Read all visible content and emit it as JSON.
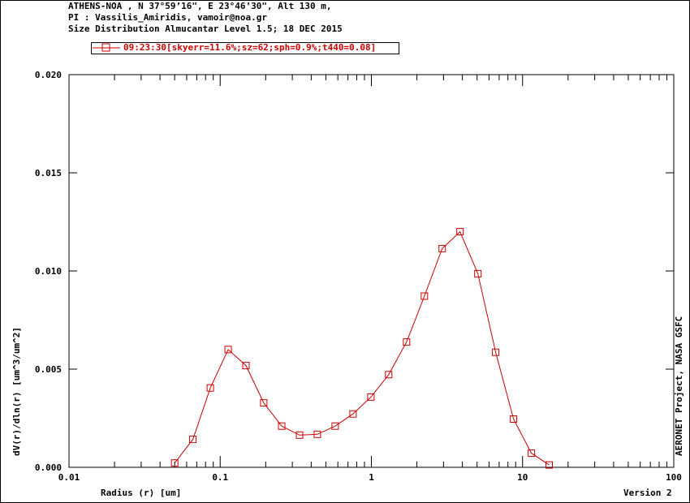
{
  "header": {
    "line1": "ATHENS-NOA , N 37°59’16\", E 23°46’30\", Alt 130 m,",
    "line2": "PI : Vassilis_Amiridis, vamoir@noa.gr",
    "line3": "Size Distribution Almucantar Level 1.5; 18 DEC 2015"
  },
  "right_label": "AERONET Project, NASA GSFC",
  "version_label": "Version 2",
  "colors": {
    "series": "#cc0000",
    "axis": "#000000"
  },
  "chart_data": {
    "type": "line",
    "xscale": "log",
    "xlabel": "Radius (r) [um]",
    "ylabel": "dV(r)/dln(r) [um^3/um^2]",
    "xlim": [
      0.01,
      100
    ],
    "ylim": [
      0.0,
      0.02
    ],
    "x_tick_labels": [
      "0.01",
      "0.1",
      "1",
      "10",
      "100"
    ],
    "y_tick_labels": [
      "0.000",
      "0.005",
      "0.010",
      "0.015",
      "0.020"
    ],
    "x_tick_values": [
      0.01,
      0.1,
      1,
      10,
      100
    ],
    "y_tick_values": [
      0,
      0.005,
      0.01,
      0.015,
      0.02
    ],
    "grid": false,
    "legend_position": "top-left",
    "series": [
      {
        "name": "09:23:30[skyerr=11.6%;sz=62;sph=0.9%;t440=0.08]",
        "marker": "square",
        "x": [
          0.05,
          0.066,
          0.086,
          0.113,
          0.148,
          0.194,
          0.255,
          0.335,
          0.439,
          0.576,
          0.756,
          0.992,
          1.302,
          1.708,
          2.241,
          2.94,
          3.857,
          5.061,
          6.641,
          8.713,
          11.43,
          15.0
        ],
        "y": [
          0.00022,
          0.00142,
          0.00404,
          0.006,
          0.00518,
          0.00328,
          0.0021,
          0.00164,
          0.00168,
          0.0021,
          0.00272,
          0.00358,
          0.00472,
          0.00638,
          0.00872,
          0.01114,
          0.012,
          0.00986,
          0.00586,
          0.00246,
          0.00072,
          0.00012
        ]
      }
    ]
  }
}
